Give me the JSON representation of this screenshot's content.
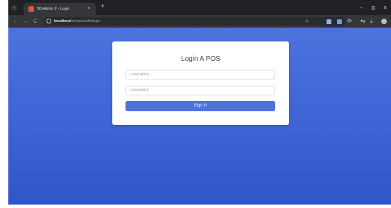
{
  "browser": {
    "tab": {
      "title": "SB Admin 2 - Login",
      "close": "×",
      "favicon_color": "#e8542f"
    },
    "tabs_menu_glyph": "⌄",
    "new_tab": "+",
    "window_controls": {
      "minimize": "−",
      "maximize": "ɑ",
      "close": "×"
    },
    "nav": {
      "back": "←",
      "forward": "→",
      "reload": "C"
    },
    "address": {
      "host": "localhost",
      "path": "/skripsi/auth/login"
    },
    "toolbar_icons": {
      "bookmark": "☆",
      "sync": "⟳",
      "tab_search": "⇆",
      "download": "⤓",
      "more": "⋮"
    }
  },
  "page": {
    "background_top": "#4d73dd",
    "background_bottom": "#2f55c9",
    "login": {
      "title": "Login A POS",
      "username_placeholder": "Username...",
      "password_placeholder": "Password",
      "sign_in_label": "Sign In",
      "button_color": "#4e73df"
    }
  }
}
